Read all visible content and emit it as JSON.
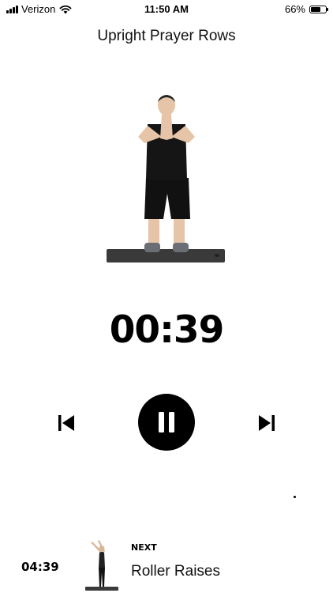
{
  "status_bar": {
    "carrier": "Verizon",
    "time": "11:50 AM",
    "battery_text": "66%",
    "battery_level": 0.66
  },
  "exercise": {
    "title": "Upright Prayer Rows"
  },
  "timer": {
    "display": "00:39"
  },
  "controls": {
    "prev_icon": "skip-previous-icon",
    "pause_icon": "pause-icon",
    "next_icon": "skip-next-icon"
  },
  "next_up": {
    "total_remaining": "04:39",
    "label": "NEXT",
    "name": "Roller Raises"
  }
}
